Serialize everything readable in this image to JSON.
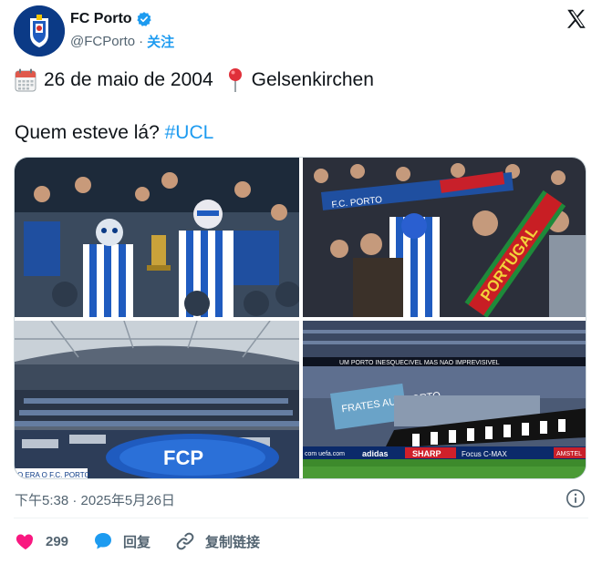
{
  "header": {
    "display_name": "FC Porto",
    "handle": "@FCPorto",
    "separator": "·",
    "follow_label": "关注"
  },
  "post": {
    "date_text": "26 de maio de 2004",
    "location_text": "Gelsenkirchen",
    "question_text": "Quem esteve lá?",
    "hashtag": "#UCL"
  },
  "media": {
    "banner_portugal": "PORTUGAL",
    "banner_porto": "F.C. PORTO",
    "stadium_banner": "UM PORTO INESQUECIVEL MAS NAO IMPREVISIVEL",
    "bottom_left_caption": "O ERA O F.C. PORTO",
    "ad_com": "com  uefa.com",
    "ad_adidas": "adidas",
    "ad_sharp": "SHARP",
    "ad_focus": "Focus C-MAX",
    "ad_amstel": "AMSTEL",
    "tifo_text": "FRATES  AUS PORTO"
  },
  "meta": {
    "timestamp": "下午5:38 · 2025年5月26日"
  },
  "actions": {
    "like_count": "299",
    "reply_label": "回复",
    "copy_link_label": "复制链接"
  },
  "colors": {
    "accent": "#1d9bf0",
    "like": "#f91880",
    "porto_blue": "#0b3a86"
  }
}
